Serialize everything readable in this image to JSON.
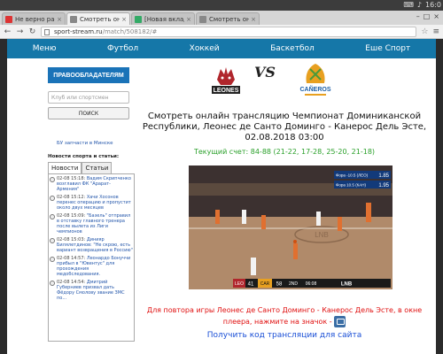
{
  "os": {
    "status": "16:0"
  },
  "browser": {
    "tabs": [
      {
        "label": "Не верно рассчит",
        "color": "#d33"
      },
      {
        "label": "Смотреть онлай",
        "color": "#888",
        "active": true
      },
      {
        "label": "[Новая вкладка -",
        "color": "#3a6"
      },
      {
        "label": "Смотреть онла",
        "color": "#888"
      }
    ],
    "url_host": "sport-stream.ru",
    "url_path": "/match/508182/#"
  },
  "nav": {
    "items": [
      "Меню",
      "Футбол",
      "Хоккей",
      "Баскетбол",
      "Еше Спорт"
    ]
  },
  "sidebar": {
    "brand": "ПРАВООБЛАДАТЕЛЯМ",
    "search_placeholder": "Клуб или спортсмен",
    "search_button": "ПОИСК",
    "spare_link": "БУ запчасти в Минске",
    "news_heading": "Новости спорта и статьи:",
    "tab_news": "Новости",
    "tab_articles": "Статьи",
    "news": [
      {
        "time": "02-08 15:18:",
        "title": "Вадим Скрипченко возглавил ФК \"Арарат-Армения\""
      },
      {
        "time": "02-08 15:12:",
        "title": "Хачи Хосонов перенес операцию и пропустит около двух месяцев"
      },
      {
        "time": "02-08 15:09:",
        "title": "\"Базель\" отправил в отставку главного тренера после вылета из Лиги чемпионов"
      },
      {
        "time": "02-08 15:03:",
        "title": "Динияр Билялетдинов: \"Не скрою, есть вариант возвращения в Россию\""
      },
      {
        "time": "02-08 14:57:",
        "title": "Леонардо Бонуччи прибыл в \"Ювентус\" для прохождения медобследования."
      },
      {
        "time": "02-08 14:54:",
        "title": "Дмитрий Губерниев призвал дать Фёдору Смолову звание ЗМС по..."
      }
    ]
  },
  "match": {
    "home_logo": "LEONES",
    "vs": "VS",
    "away_logo": "CAÑEROS",
    "title": "Смотреть онлайн трансляцию Чемпионат Доминиканской Республики, Леонес де Санто Доминго - Канерос Дель Эсте, 02.08.2018 03:00",
    "score": "Текущий счет: 84-88 (21-22, 17-28, 25-20, 21-18)",
    "replay_text": "Для повтора игры Леонес де Санто Доминго - Канерос Дель Эсте, в окне плеера, нажмите на значок -",
    "get_code": "Получить код трансляции для сайта"
  },
  "video": {
    "odds": [
      {
        "label": "Фора -10.5 (ЛЕО)",
        "value": "1.85"
      },
      {
        "label": "Фора 10.5 (КАН)",
        "value": "1.95"
      }
    ],
    "scorebug": {
      "home": "LEO",
      "home_score": "41",
      "away": "CAR",
      "away_score": "58",
      "period": "2ND",
      "clock": "06:08",
      "league": "LNB"
    }
  }
}
